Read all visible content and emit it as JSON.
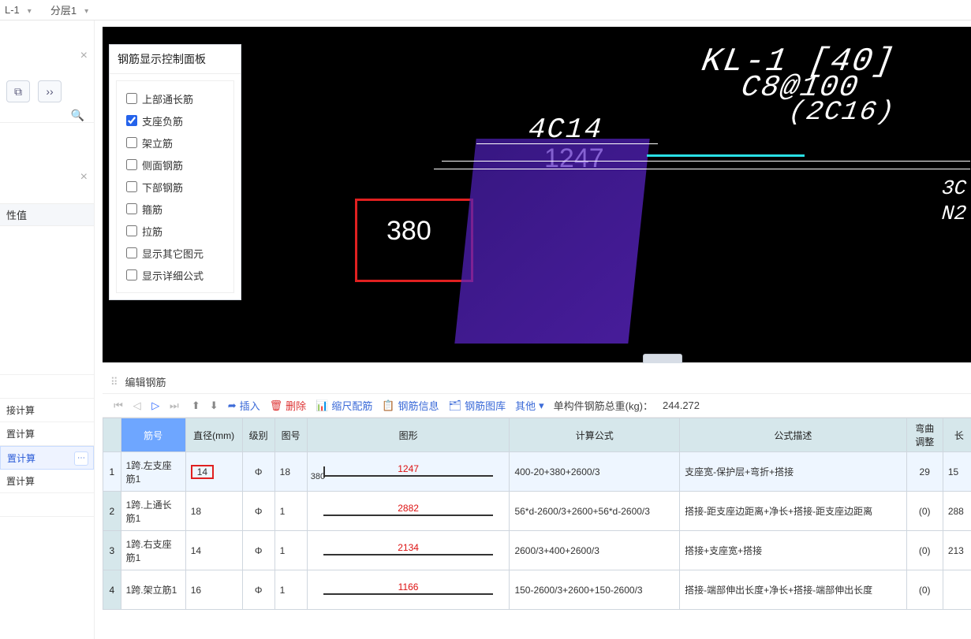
{
  "top": {
    "sel1": "L-1",
    "sel2": "分层1"
  },
  "left": {
    "close": "×",
    "prop_header": "性值",
    "items": [
      "",
      "",
      "接计算",
      "置计算",
      "置计算",
      "置计算",
      ""
    ]
  },
  "panel": {
    "title": "钢筋显示控制面板",
    "options": [
      {
        "label": "上部通长筋",
        "checked": false
      },
      {
        "label": "支座负筋",
        "checked": true
      },
      {
        "label": "架立筋",
        "checked": false
      },
      {
        "label": "侧面钢筋",
        "checked": false
      },
      {
        "label": "下部钢筋",
        "checked": false
      },
      {
        "label": "箍筋",
        "checked": false
      },
      {
        "label": "拉筋",
        "checked": false
      },
      {
        "label": "显示其它图元",
        "checked": false
      },
      {
        "label": "显示详细公式",
        "checked": false
      }
    ]
  },
  "viewport": {
    "label_380": "380",
    "label_4c14": "4C14",
    "label_1247": "1247",
    "label_kl1": "KL-1 [40]",
    "label_c8": "C8@100",
    "label_2c16": "(2C16)",
    "label_3c": "3C",
    "label_n2": "N2"
  },
  "bottom": {
    "title": "编辑钢筋",
    "toolbar": {
      "insert": "插入",
      "delete": "删除",
      "scale": "缩尺配筋",
      "info": "钢筋信息",
      "lib": "钢筋图库",
      "other": "其他",
      "weight_label": "单构件钢筋总重(kg)：",
      "weight_value": "244.272"
    },
    "columns": [
      "筋号",
      "直径(mm)",
      "级别",
      "图号",
      "图形",
      "计算公式",
      "公式描述",
      "弯曲调整",
      "长"
    ],
    "rows": [
      {
        "name": "1跨.左支座筋1",
        "dia": "14",
        "grade": "Φ",
        "fig": "18",
        "shape_left": "380",
        "shape_num": "1247",
        "formula": "400-20+380+2600/3",
        "desc": "支座宽-保护层+弯折+搭接",
        "bend": "29",
        "len": "15"
      },
      {
        "name": "1跨.上通长筋1",
        "dia": "18",
        "grade": "Φ",
        "fig": "1",
        "shape_left": "",
        "shape_num": "2882",
        "formula": "56*d-2600/3+2600+56*d-2600/3",
        "desc": "搭接-距支座边距离+净长+搭接-距支座边距离",
        "bend": "(0)",
        "len": "288"
      },
      {
        "name": "1跨.右支座筋1",
        "dia": "14",
        "grade": "Φ",
        "fig": "1",
        "shape_left": "",
        "shape_num": "2134",
        "formula": "2600/3+400+2600/3",
        "desc": "搭接+支座宽+搭接",
        "bend": "(0)",
        "len": "213"
      },
      {
        "name": "1跨.架立筋1",
        "dia": "16",
        "grade": "Φ",
        "fig": "1",
        "shape_left": "",
        "shape_num": "1166",
        "formula": "150-2600/3+2600+150-2600/3",
        "desc": "搭接-端部伸出长度+净长+搭接-端部伸出长度",
        "bend": "(0)",
        "len": ""
      }
    ]
  }
}
